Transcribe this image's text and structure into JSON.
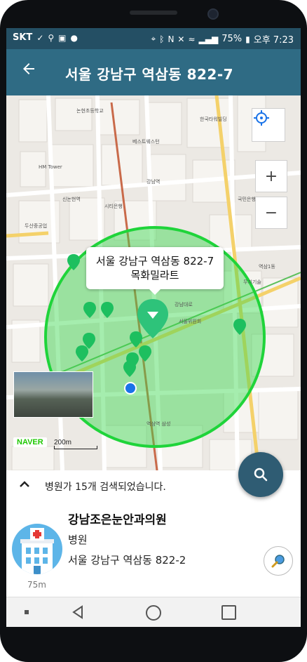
{
  "status_bar": {
    "carrier": "SKT",
    "battery": "75%",
    "time": "오후 7:23"
  },
  "app_bar": {
    "back_icon": "arrow-left-icon",
    "title": "서울 강남구 역삼동 822-7"
  },
  "map": {
    "labels": [
      "HM Tower",
      "신논현역",
      "논현초등학교",
      "두산중공업",
      "베스트웨스턴",
      "강남역",
      "한국타워빌딩",
      "시티은행",
      "역삼역 삼성",
      "서울위원회",
      "무지기술",
      "국민은행",
      "역삼1동",
      "강남대로"
    ],
    "selected_marker": {
      "line1": "서울 강남구 역삼동 822-7",
      "line2": "목화밀라트"
    },
    "radius_color": "#2ed84a",
    "marker_color": "#2ec37a",
    "current_location_color": "#1a73e8",
    "brand": "NAVER",
    "scale": "200m",
    "controls": {
      "locate_icon": "crosshair-icon",
      "zoom_in": "+",
      "zoom_out": "−"
    }
  },
  "search_fab_icon": "search-icon",
  "panel": {
    "toggle_icon": "chevron-up-icon",
    "result_text": "병원가 15개 검색되었습니다.",
    "place": {
      "name": "강남조은눈안과의원",
      "category": "병원",
      "address": "서울 강남구 역삼동 822-2",
      "distance": "75m",
      "icon": "hospital-icon",
      "action_icon": "magnifier-icon"
    }
  },
  "nav_bar": {
    "back_icon": "nav-back-icon",
    "home_icon": "nav-home-icon",
    "recents_icon": "nav-recents-icon"
  }
}
